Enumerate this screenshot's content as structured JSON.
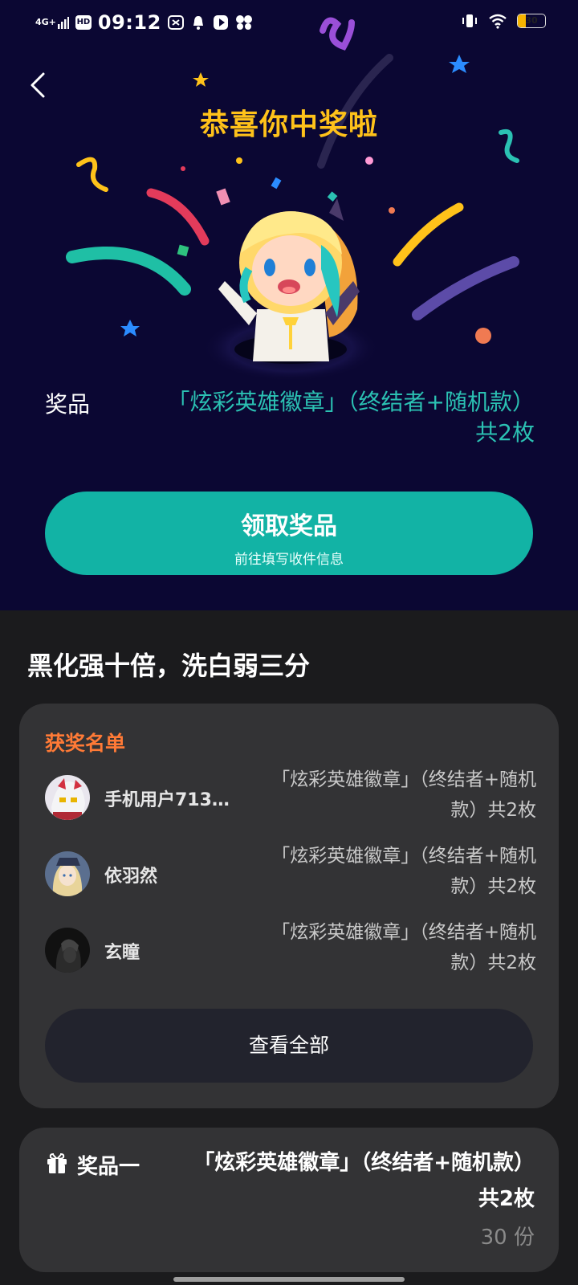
{
  "status_bar": {
    "network": "4G+",
    "hd": "HD",
    "time": "09:12",
    "battery_level": 0.3,
    "battery_text": "30",
    "battery_color": "#f6b400"
  },
  "hero": {
    "title": "恭喜你中奖啦",
    "prize_label": "奖品",
    "prize_value": "「炫彩英雄徽章」（终结者+随机款）共2枚",
    "claim_button_title": "领取奖品",
    "claim_button_subtitle": "前往填写收件信息",
    "accent_color": "#12b3a5",
    "title_color": "#ffc21a"
  },
  "section_title": "黑化强十倍，洗白弱三分",
  "winners": {
    "title": "获奖名单",
    "items": [
      {
        "name": "手机用户713…",
        "prize": "「炫彩英雄徽章」（终结者+随机款）共2枚"
      },
      {
        "name": "依羽然",
        "prize": "「炫彩英雄徽章」（终结者+随机款）共2枚"
      },
      {
        "name": "玄瞳",
        "prize": "「炫彩英雄徽章」（终结者+随机款）共2枚"
      }
    ],
    "view_all_label": "查看全部"
  },
  "prize_card": {
    "icon": "gift-icon",
    "label": "奖品一",
    "value": "「炫彩英雄徽章」（终结者+随机款）共2枚",
    "count": "30 份"
  }
}
